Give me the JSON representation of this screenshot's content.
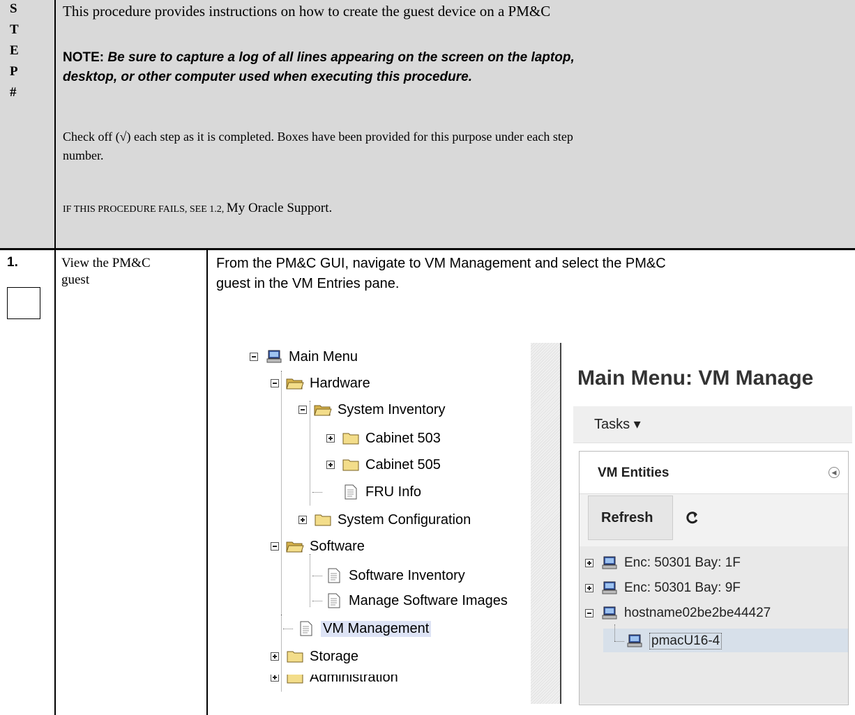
{
  "header": {
    "step_letters": [
      "S",
      "T",
      "E",
      "P",
      "#"
    ],
    "intro": "This procedure provides instructions on how to create the guest device on a PM&C",
    "note_label": "NOTE:",
    "note_text_1": "Be sure to capture a log of all lines appearing on the screen on the laptop,",
    "note_text_2": "desktop, or other computer used when executing this procedure.",
    "check_text_1": "Check off (√) each step as it is completed.  Boxes have been provided for this purpose under each step",
    "check_text_2": "number.",
    "fail_prefix": "IF THIS PROCEDURE FAILS, SEE 1.2, ",
    "fail_link": "My Oracle Support."
  },
  "step1": {
    "number": "1.",
    "title_line1": "View the PM&C",
    "title_line2": "guest",
    "instruction_line1": "From the PM&C GUI, navigate to VM Management and select the PM&C",
    "instruction_line2": "guest in the VM Entries pane."
  },
  "tree": {
    "main_menu": "Main Menu",
    "hardware": "Hardware",
    "system_inventory": "System Inventory",
    "cabinet_503": "Cabinet 503",
    "cabinet_505": "Cabinet 505",
    "fru_info": "FRU Info",
    "system_configuration": "System Configuration",
    "software": "Software",
    "software_inventory": "Software Inventory",
    "manage_software_images": "Manage Software Images",
    "vm_management": "VM Management",
    "storage": "Storage",
    "administration": "Administration"
  },
  "pane": {
    "title": "Main Menu: VM Manage",
    "tasks": "Tasks ▾",
    "vm_entities": "VM Entities",
    "refresh": "Refresh",
    "entries": [
      "Enc: 50301 Bay: 1F",
      "Enc: 50301 Bay: 9F",
      "hostname02be2be44427",
      "pmacU16-4"
    ]
  },
  "colors": {
    "header_bg": "#d9d9d9",
    "selection": "#dde3f5"
  }
}
